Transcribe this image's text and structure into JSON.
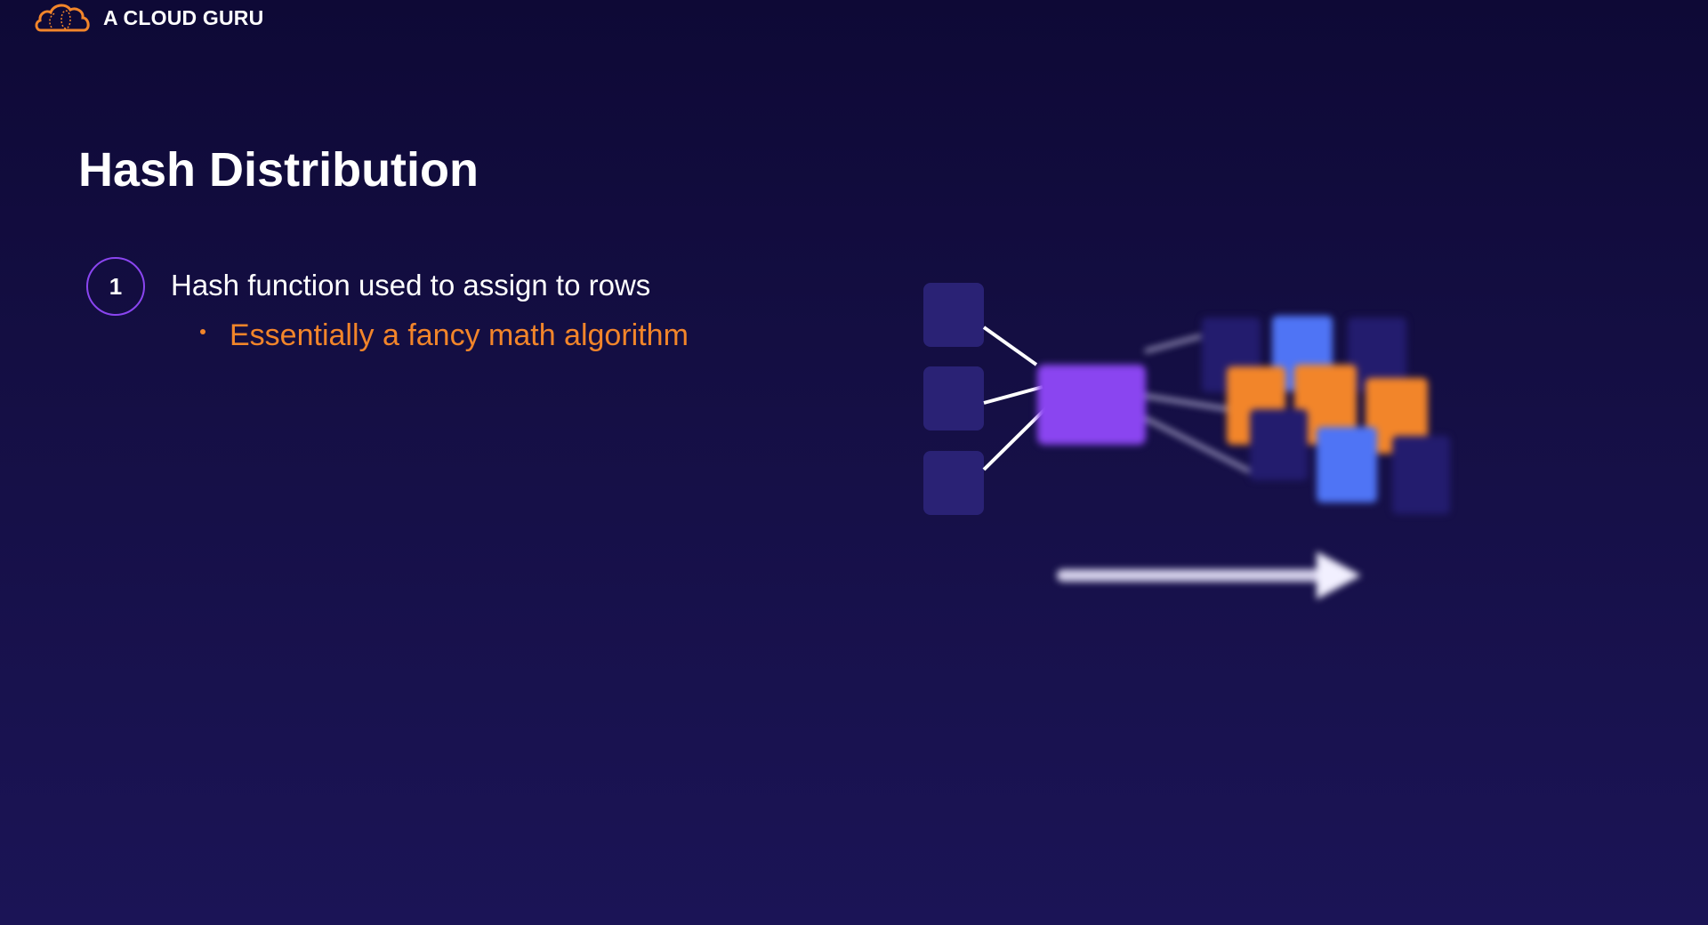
{
  "brand": {
    "name": "A CLOUD GURU",
    "icon": "cloud-logo-icon",
    "color": "#f2852a"
  },
  "slide": {
    "title": "Hash Distribution",
    "points": [
      {
        "number": "1",
        "text": "Hash function used to assign to rows",
        "subpoints": [
          "Essentially a fancy math algorithm"
        ]
      }
    ]
  },
  "colors": {
    "accent_purple": "#8a45f0",
    "orange": "#f2852a",
    "blue": "#4f74f5",
    "dark_block": "#2a2275"
  }
}
